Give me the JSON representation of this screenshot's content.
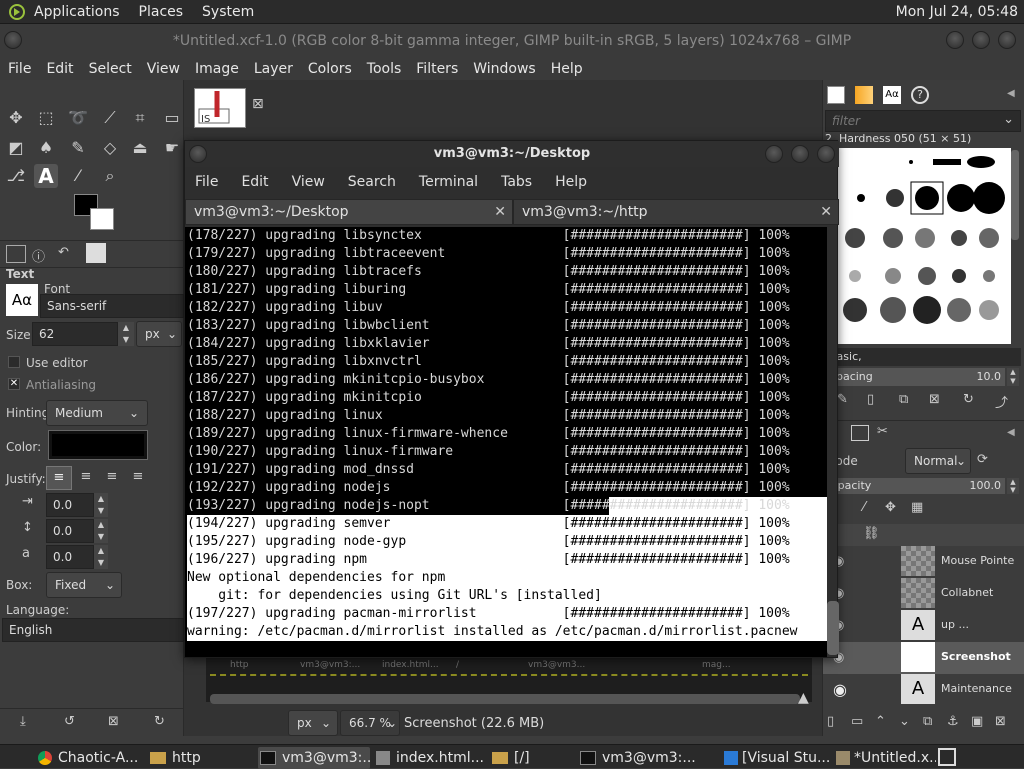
{
  "system_panel": {
    "menus": [
      "Applications",
      "Places",
      "System"
    ],
    "clock": "Mon Jul 24, 05:48"
  },
  "gimp": {
    "title": "*Untitled.xcf-1.0 (RGB color 8-bit gamma integer, GIMP built-in sRGB, 5 layers) 1024x768 – GIMP",
    "menu": [
      "File",
      "Edit",
      "Select",
      "View",
      "Image",
      "Layer",
      "Colors",
      "Tools",
      "Filters",
      "Windows",
      "Help"
    ],
    "tool_options": {
      "section": "Text",
      "font_label": "Font",
      "font_value": "Sans-serif",
      "size_label": "Size:",
      "size_value": "62",
      "size_unit": "px",
      "use_editor": "Use editor",
      "antialiasing": "Antialiasing",
      "hinting_label": "Hinting:",
      "hinting_value": "Medium",
      "color_label": "Color:",
      "justify_label": "Justify:",
      "indent_value": "0.0",
      "line_spacing_value": "0.0",
      "letter_spacing_value": "0.0",
      "box_label": "Box:",
      "box_value": "Fixed",
      "language_label": "Language:",
      "language_value": "English",
      "font_preview": "Aα"
    },
    "brushes": {
      "filter_placeholder": "filter",
      "brush_name": "2. Hardness 050 (51 × 51)",
      "tag": "Basic,",
      "spacing_label": "Spacing",
      "spacing_value": "10.0"
    },
    "layers": {
      "mode_label": "Mode",
      "mode_value": "Normal",
      "opacity_label": "Opacity",
      "opacity_value": "100.0",
      "items": [
        {
          "name": "Mouse Pointe"
        },
        {
          "name": "Collabnet"
        },
        {
          "name": "up ..."
        },
        {
          "name": "Screenshot"
        },
        {
          "name": "Maintenance"
        }
      ]
    },
    "statusbar": {
      "unit": "px",
      "zoom": "66.7 %",
      "info": "Screenshot (22.6 MB)"
    },
    "canvas_tabs": [
      "http",
      "vm3@vm3:...",
      "index.html...",
      "/",
      "vm3@vm3...",
      "mag..."
    ]
  },
  "terminal": {
    "title": "vm3@vm3:~/Desktop",
    "menu": [
      "File",
      "Edit",
      "View",
      "Search",
      "Terminal",
      "Tabs",
      "Help"
    ],
    "tabs": [
      "vm3@vm3:~/Desktop",
      "vm3@vm3:~/http"
    ],
    "lines": [
      {
        "text": "(178/227) upgrading libsynctex                  [######################] 100%",
        "style": "dark"
      },
      {
        "text": "(179/227) upgrading libtraceevent               [######################] 100%",
        "style": "dark"
      },
      {
        "text": "(180/227) upgrading libtracefs                  [######################] 100%",
        "style": "dark"
      },
      {
        "text": "(181/227) upgrading liburing                    [######################] 100%",
        "style": "dark"
      },
      {
        "text": "(182/227) upgrading libuv                       [######################] 100%",
        "style": "dark"
      },
      {
        "text": "(183/227) upgrading libwbclient                 [######################] 100%",
        "style": "dark"
      },
      {
        "text": "(184/227) upgrading libxklavier                 [######################] 100%",
        "style": "dark"
      },
      {
        "text": "(185/227) upgrading libxnvctrl                  [######################] 100%",
        "style": "dark"
      },
      {
        "text": "(186/227) upgrading mkinitcpio-busybox          [######################] 100%",
        "style": "dark"
      },
      {
        "text": "(187/227) upgrading mkinitcpio                  [######################] 100%",
        "style": "dark"
      },
      {
        "text": "(188/227) upgrading linux                       [######################] 100%",
        "style": "dark"
      },
      {
        "text": "(189/227) upgrading linux-firmware-whence       [######################] 100%",
        "style": "dark"
      },
      {
        "text": "(190/227) upgrading linux-firmware              [######################] 100%",
        "style": "dark"
      },
      {
        "text": "(191/227) upgrading mod_dnssd                   [######################] 100%",
        "style": "dark"
      },
      {
        "text": "(192/227) upgrading nodejs                      [######################] 100%",
        "style": "dark"
      },
      {
        "text": "(193/227) upgrading nodejs-nopt                 [######################] 100%",
        "style": "mixed"
      },
      {
        "text": "(194/227) upgrading semver                      [######################] 100%",
        "style": "light"
      },
      {
        "text": "(195/227) upgrading node-gyp                    [######################] 100%",
        "style": "light"
      },
      {
        "text": "(196/227) upgrading npm                         [######################] 100%",
        "style": "light"
      },
      {
        "text": "New optional dependencies for npm",
        "style": "light"
      },
      {
        "text": "    git: for dependencies using Git URL's [installed]",
        "style": "light"
      },
      {
        "text": "(197/227) upgrading pacman-mirrorlist           [######################] 100%",
        "style": "light"
      },
      {
        "text": "warning: /etc/pacman.d/mirrorlist installed as /etc/pacman.d/mirrorlist.pacnew",
        "style": "light"
      }
    ]
  },
  "taskbar": {
    "items": [
      "Chaotic-A...",
      "http",
      "vm3@vm3:...",
      "index.html...",
      "[/]",
      "vm3@vm3:...",
      "[Visual Stu...",
      "*Untitled.x..."
    ]
  },
  "colors": {
    "terminal_bg": "#000000",
    "panel_bg": "#3c3c3c",
    "selected_layer": "#5a5a5a"
  }
}
